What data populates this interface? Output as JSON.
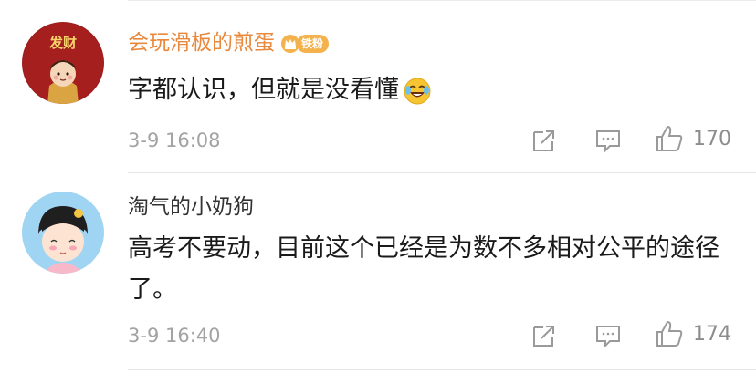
{
  "comments": [
    {
      "username": "会玩滑板的煎蛋",
      "username_color": "#e8893e",
      "badge_label": "铁粉",
      "avatar_text": "发财",
      "text": "字都认识，但就是没看懂",
      "emoji": "laugh-cry-emoji",
      "time": "3-9 16:08",
      "likes": "170"
    },
    {
      "username": "淘气的小奶狗",
      "username_color": "#333333",
      "text": "高考不要动，目前这个已经是为数不多相对公平的途径了。",
      "time": "3-9 16:40",
      "likes": "174"
    }
  ],
  "colors": {
    "icon_gray": "#9a9a9a",
    "divider": "#e6e6e6",
    "badge_orange": "#f3b24b"
  }
}
